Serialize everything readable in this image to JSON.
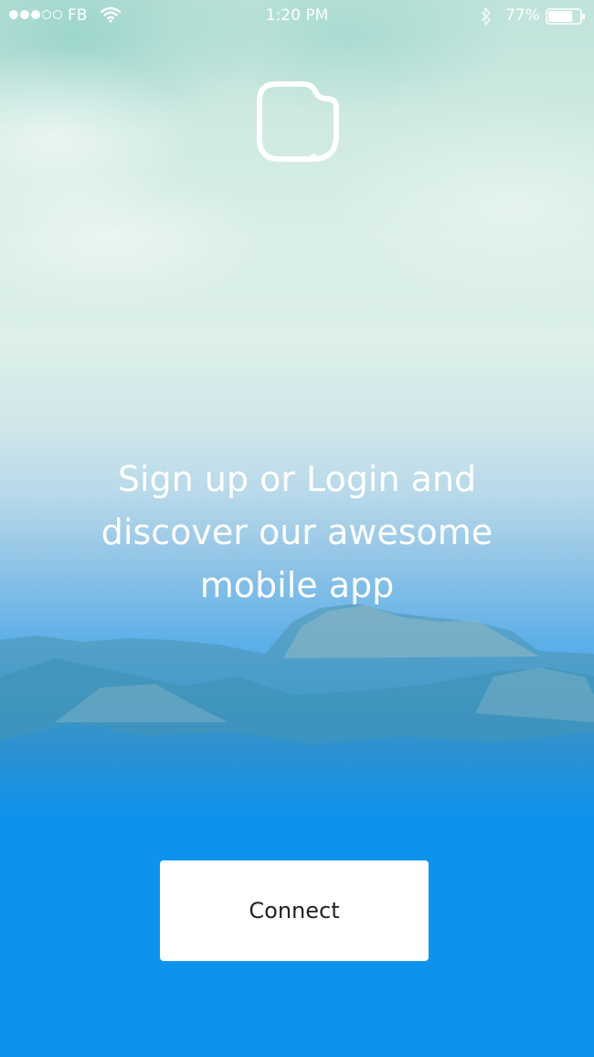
{
  "status_bar": {
    "carrier": "FB",
    "time": "1:20 PM",
    "battery_percent": "77%",
    "battery_level": 0.77,
    "signal_bars_filled": 3,
    "signal_bars_total": 5,
    "icons": [
      "wifi-icon",
      "bluetooth-icon",
      "battery-icon"
    ]
  },
  "logo": {
    "icon": "app-logo-icon"
  },
  "headline": {
    "lines": [
      "Sign up or Login and",
      "discover our awesome",
      "mobile app"
    ]
  },
  "connect_button": {
    "label": "Connect"
  },
  "colors": {
    "primary_blue": "#0b93ee",
    "sky_green": "#bfe3da",
    "button_bg": "#ffffff",
    "button_text": "#222222"
  }
}
